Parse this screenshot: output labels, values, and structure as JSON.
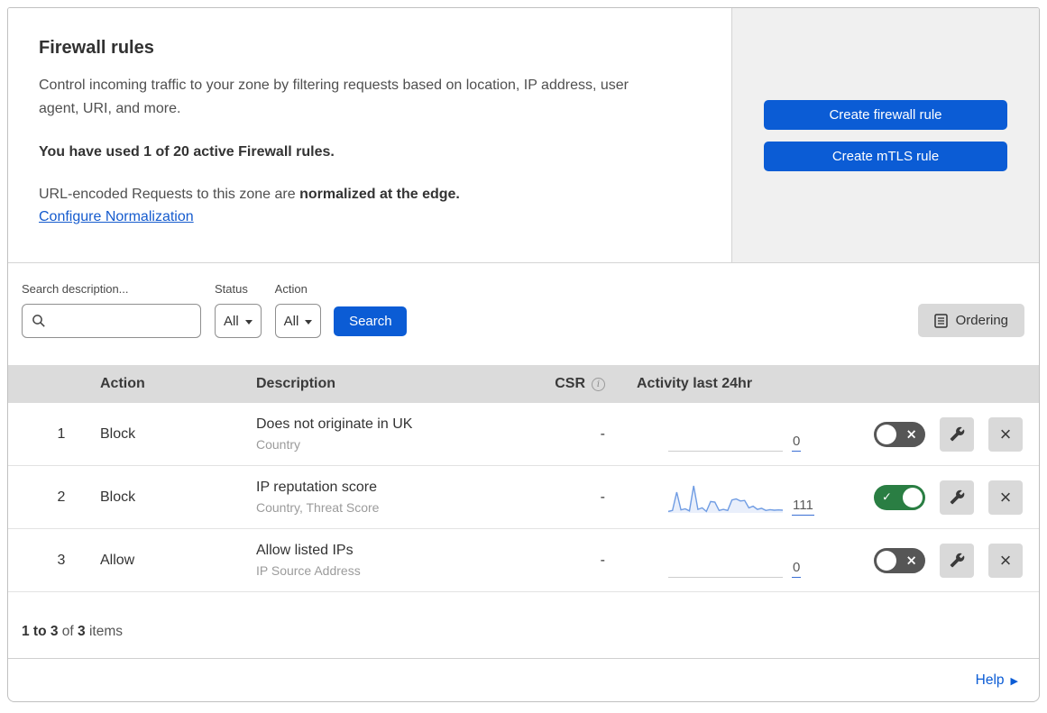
{
  "intro": {
    "title": "Firewall rules",
    "description": "Control incoming traffic to your zone by filtering requests based on location, IP address, user agent, URI, and more.",
    "usage": "You have used 1 of 20 active Firewall rules.",
    "normalization_prefix": "URL-encoded Requests to this zone are ",
    "normalization_bold": "normalized at the edge.",
    "normalization_link": "Configure Normalization"
  },
  "actions": {
    "create_firewall_rule": "Create firewall rule",
    "create_mtls_rule": "Create mTLS rule"
  },
  "filters": {
    "search_label": "Search description...",
    "search_value": "",
    "status_label": "Status",
    "status_value": "All",
    "action_label": "Action",
    "action_value": "All",
    "search_button": "Search",
    "ordering_button": "Ordering"
  },
  "table": {
    "columns": {
      "action": "Action",
      "description": "Description",
      "csr": "CSR",
      "activity": "Activity last 24hr"
    },
    "rows": [
      {
        "num": "1",
        "action": "Block",
        "title": "Does not originate in UK",
        "subtitle": "Country",
        "csr": "-",
        "count": "0",
        "enabled": false,
        "sparkline": null
      },
      {
        "num": "2",
        "action": "Block",
        "title": "IP reputation score",
        "subtitle": "Country, Threat Score",
        "csr": "-",
        "count": "111",
        "enabled": true,
        "sparkline": [
          2,
          6,
          76,
          8,
          12,
          4,
          100,
          10,
          16,
          2,
          40,
          38,
          6,
          10,
          6,
          46,
          50,
          42,
          44,
          16,
          22,
          10,
          14,
          6,
          9,
          7,
          8,
          7
        ]
      },
      {
        "num": "3",
        "action": "Allow",
        "title": "Allow listed IPs",
        "subtitle": "IP Source Address",
        "csr": "-",
        "count": "0",
        "enabled": false,
        "sparkline": null
      }
    ]
  },
  "footer": {
    "range": "1 to 3",
    "of": " of ",
    "total": "3",
    "items": " items",
    "help": "Help"
  },
  "icons": {
    "info": "i",
    "toggle_off_cross": "×",
    "toggle_on_check": "✓",
    "delete_cross": "×",
    "help_arrow": "▶"
  },
  "colors": {
    "accent_blue": "#0b5cd5",
    "panel_gray": "#f0f0f0",
    "table_header_gray": "#dbdbdb",
    "icon_button_gray": "#d9d9d9",
    "toggle_off": "#565656",
    "toggle_on_green": "#2a7e43",
    "spark_line": "#6f9ce3",
    "spark_fill": "#e9effb",
    "link_blue": "#155bce"
  }
}
